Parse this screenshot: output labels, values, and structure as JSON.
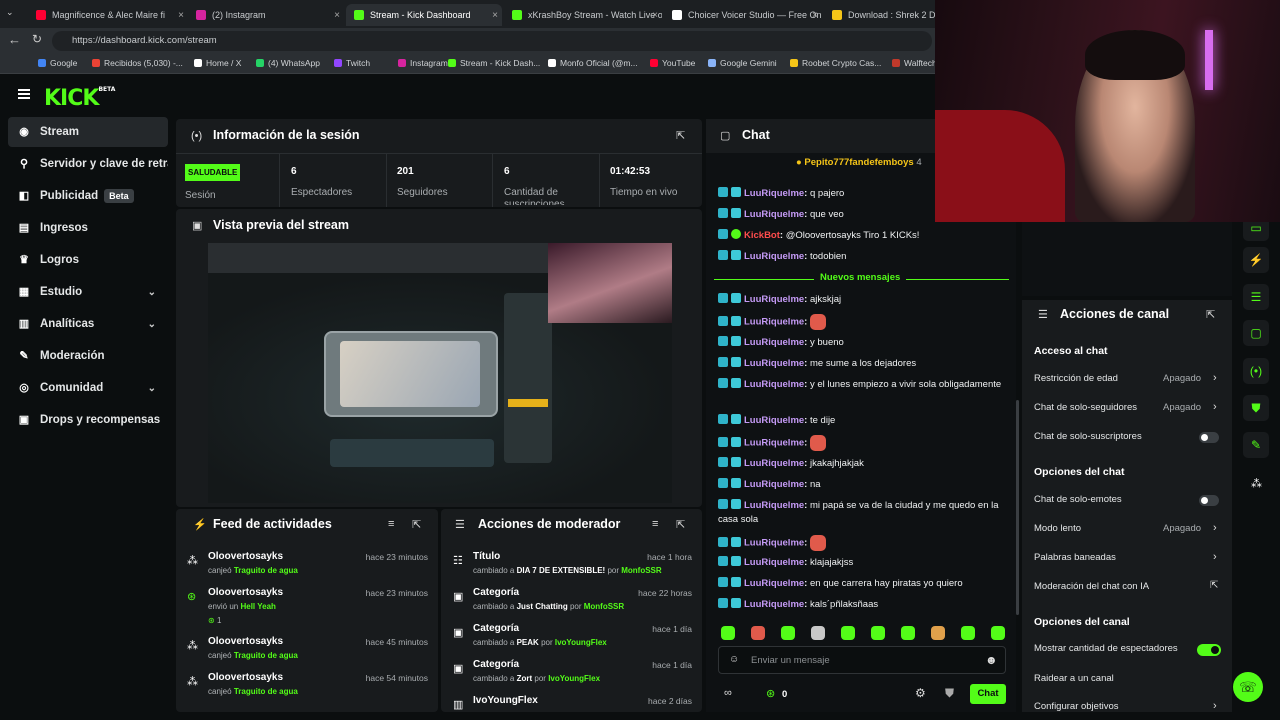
{
  "browser": {
    "tabs": [
      {
        "title": "Magnificence & Alec Maire fi",
        "fav": "#ff0033"
      },
      {
        "title": "(2) Instagram",
        "fav": "#d6249f"
      },
      {
        "title": "Stream - Kick Dashboard",
        "fav": "#53fc18",
        "active": true
      },
      {
        "title": "xKrashBoy Stream - Watch Live on",
        "fav": "#53fc18"
      },
      {
        "title": "Choicer Voicer Studio — Free Onli",
        "fav": "#ffffff"
      },
      {
        "title": "Download : Shrek 2 Dalek",
        "fav": "#f5c518"
      }
    ],
    "url": "https://dashboard.kick.com/stream",
    "bookmarks": [
      "Google",
      "Recibidos (5,030) -...",
      "Home / X",
      "(4) WhatsApp",
      "Twitch",
      "Instagram",
      "Stream - Kick Dash...",
      "Monfo Oficial (@m...",
      "YouTube",
      "Google Gemini",
      "Roobet Crypto Cas...",
      "Walftech"
    ]
  },
  "logo": {
    "text": "KICK",
    "sup": "BETA"
  },
  "sidebar": {
    "items": [
      {
        "label": "Stream",
        "icon": "broadcast-icon",
        "glyph": "◉"
      },
      {
        "label": "Servidor y clave de retransmisión",
        "icon": "key-icon",
        "glyph": "⚲"
      },
      {
        "label": "Publicidad",
        "icon": "megaphone-icon",
        "glyph": "◧",
        "badge": "Beta"
      },
      {
        "label": "Ingresos",
        "icon": "money-icon",
        "glyph": "▤"
      },
      {
        "label": "Logros",
        "icon": "trophy-icon",
        "glyph": "♛"
      },
      {
        "label": "Estudio",
        "icon": "studio-icon",
        "glyph": "▦"
      },
      {
        "label": "Analíticas",
        "icon": "chart-icon",
        "glyph": "▥"
      },
      {
        "label": "Moderación",
        "icon": "wrench-icon",
        "glyph": "✎"
      },
      {
        "label": "Comunidad",
        "icon": "community-icon",
        "glyph": "◎"
      },
      {
        "label": "Drops y recompensas",
        "icon": "drops-icon",
        "glyph": "▣"
      }
    ]
  },
  "session": {
    "title": "Información de la sesión",
    "status": "SALUDABLE",
    "status_label": "Sesión",
    "stats": [
      {
        "value": "6",
        "label": "Espectadores"
      },
      {
        "value": "201",
        "label": "Seguidores"
      },
      {
        "value": "6",
        "label": "Cantidad de suscripciones"
      },
      {
        "value": "01:42:53",
        "label": "Tiempo en vivo"
      }
    ]
  },
  "preview": {
    "title": "Vista previa del stream"
  },
  "feed": {
    "title": "Feed de actividades",
    "rows": [
      {
        "user": "Oloovertosayks",
        "action": "canjeó",
        "item": "Traguito de agua",
        "time": "hace 23 minutos"
      },
      {
        "user": "Oloovertosayks",
        "action": "envió un",
        "item": "Hell Yeah",
        "extra": "1",
        "time": "hace 23 minutos"
      },
      {
        "user": "Oloovertosayks",
        "action": "canjeó",
        "item": "Traguito de agua",
        "time": "hace 45 minutos"
      },
      {
        "user": "Oloovertosayks",
        "action": "canjeó",
        "item": "Traguito de agua",
        "time": "hace 54 minutos"
      }
    ]
  },
  "mod": {
    "title": "Acciones de moderador",
    "rows": [
      {
        "field": "Título",
        "changed": "cambiado a",
        "value": "DIA 7 DE EXTENSIBLE!",
        "by": "por",
        "user": "MonfoSSR",
        "time": "hace 1 hora"
      },
      {
        "field": "Categoría",
        "changed": "cambiado a",
        "value": "Just Chatting",
        "by": "por",
        "user": "MonfoSSR",
        "time": "hace 22 horas"
      },
      {
        "field": "Categoría",
        "changed": "cambiado a",
        "value": "PEAK",
        "by": "por",
        "user": "IvoYoungFlex",
        "time": "hace 1 día"
      },
      {
        "field": "Categoría",
        "changed": "cambiado a",
        "value": "Zort",
        "by": "por",
        "user": "IvoYoungFlex",
        "time": "hace 1 día"
      },
      {
        "field": "IvoYoungFlex",
        "changed": "",
        "value": "",
        "by": "",
        "user": "",
        "time": "hace 2 días"
      }
    ]
  },
  "chat": {
    "title": "Chat",
    "pinned_user": "Pepito777fandefemboys",
    "pinned_count": "4",
    "messages": [
      {
        "user": "LuuRiquelme",
        "text": "q pajero"
      },
      {
        "user": "LuuRiquelme",
        "text": "que veo"
      },
      {
        "user": "KickBot",
        "text": "@Oloovertosayks Tiro 1 KICKs!",
        "bot": true
      },
      {
        "user": "LuuRiquelme",
        "text": "todobien"
      },
      {
        "divider": "Nuevos mensajes"
      },
      {
        "user": "LuuRiquelme",
        "text": "ajkskjaj"
      },
      {
        "user": "LuuRiquelme",
        "text": "",
        "emote": true
      },
      {
        "user": "LuuRiquelme",
        "text": "y bueno"
      },
      {
        "user": "LuuRiquelme",
        "text": "me sume a los dejadores"
      },
      {
        "user": "LuuRiquelme",
        "text": "y el lunes empiezo a vivir sola obligadamente"
      },
      {
        "user": "LuuRiquelme",
        "text": "te dije"
      },
      {
        "user": "LuuRiquelme",
        "text": "",
        "emote": true
      },
      {
        "user": "LuuRiquelme",
        "text": "jkakajhjakjak"
      },
      {
        "user": "LuuRiquelme",
        "text": "na"
      },
      {
        "user": "LuuRiquelme",
        "text": "mi papá se va de la ciudad y me quedo en la casa sola"
      },
      {
        "user": "LuuRiquelme",
        "text": "",
        "emote": true
      },
      {
        "user": "LuuRiquelme",
        "text": "klajajakjss"
      },
      {
        "user": "LuuRiquelme",
        "text": "en que carrera hay piratas yo quiero"
      },
      {
        "user": "LuuRiquelme",
        "text": "kals´pñlaksñaas"
      }
    ],
    "input_placeholder": "Enviar un mensaje",
    "points": "0",
    "send_label": "Chat"
  },
  "channel_actions": {
    "title": "Acciones de canal",
    "sections": [
      {
        "heading": "Acceso al chat"
      },
      {
        "label": "Restricción de edad",
        "value": "Apagado",
        "kind": "link"
      },
      {
        "label": "Chat de solo-seguidores",
        "value": "Apagado",
        "kind": "link"
      },
      {
        "label": "Chat de solo-suscriptores",
        "kind": "toggle",
        "on": false
      },
      {
        "heading": "Opciones del chat"
      },
      {
        "label": "Chat de solo-emotes",
        "kind": "toggle",
        "on": false
      },
      {
        "label": "Modo lento",
        "value": "Apagado",
        "kind": "link"
      },
      {
        "label": "Palabras baneadas",
        "kind": "link"
      },
      {
        "label": "Moderación del chat con IA",
        "kind": "external"
      },
      {
        "heading": "Opciones del canal"
      },
      {
        "label": "Mostrar cantidad de espectadores",
        "kind": "toggle",
        "on": true
      },
      {
        "label": "Raidear a un canal",
        "kind": "none"
      },
      {
        "label": "Configurar objetivos",
        "kind": "link"
      }
    ]
  },
  "colors": {
    "accent": "#53fc18",
    "bg": "#0b0e0f",
    "panel": "#181b1d",
    "username": "#c49af5",
    "bot": "#ff4d4d"
  }
}
